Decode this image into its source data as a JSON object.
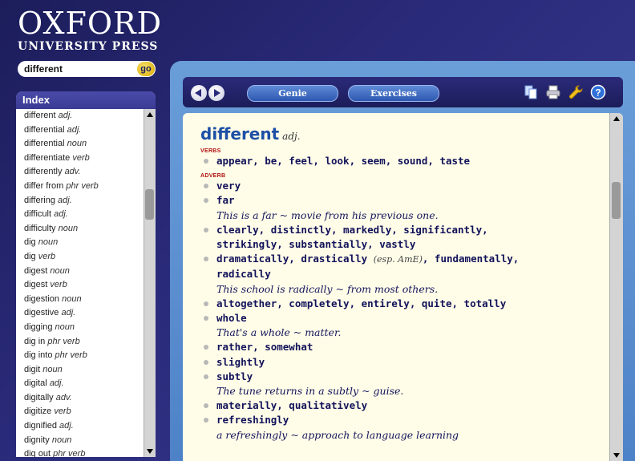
{
  "brand": {
    "name": "OXFORD",
    "subtitle": "UNIVERSITY PRESS"
  },
  "search": {
    "value": "different",
    "go_label": "go"
  },
  "index": {
    "title": "Index",
    "items": [
      {
        "word": "different",
        "pos": "adj."
      },
      {
        "word": "differential",
        "pos": "adj."
      },
      {
        "word": "differential",
        "pos": "noun"
      },
      {
        "word": "differentiate",
        "pos": "verb"
      },
      {
        "word": "differently",
        "pos": "adv."
      },
      {
        "word": "differ from",
        "pos": "phr verb"
      },
      {
        "word": "differing",
        "pos": "adj."
      },
      {
        "word": "difficult",
        "pos": "adj."
      },
      {
        "word": "difficulty",
        "pos": "noun"
      },
      {
        "word": "dig",
        "pos": "noun"
      },
      {
        "word": "dig",
        "pos": "verb"
      },
      {
        "word": "digest",
        "pos": "noun"
      },
      {
        "word": "digest",
        "pos": "verb"
      },
      {
        "word": "digestion",
        "pos": "noun"
      },
      {
        "word": "digestive",
        "pos": "adj."
      },
      {
        "word": "digging",
        "pos": "noun"
      },
      {
        "word": "dig in",
        "pos": "phr verb"
      },
      {
        "word": "dig into",
        "pos": "phr verb"
      },
      {
        "word": "digit",
        "pos": "noun"
      },
      {
        "word": "digital",
        "pos": "adj."
      },
      {
        "word": "digitally",
        "pos": "adv."
      },
      {
        "word": "digitize",
        "pos": "verb"
      },
      {
        "word": "dignified",
        "pos": "adj."
      },
      {
        "word": "dignity",
        "pos": "noun"
      },
      {
        "word": "dig out",
        "pos": "phr verb"
      }
    ]
  },
  "toolbar": {
    "genie_label": "Genie",
    "exercises_label": "Exercises",
    "icons": [
      "copy-icon",
      "print-icon",
      "wrench-icon",
      "help-icon"
    ]
  },
  "entry": {
    "headword": "different",
    "pos": "adj.",
    "sections": [
      {
        "label": "VERBS",
        "lines": [
          {
            "type": "collocate",
            "text": "appear, be, feel, look, seem, sound, taste"
          }
        ]
      },
      {
        "label": "ADVERB",
        "lines": [
          {
            "type": "collocate",
            "text": "very"
          },
          {
            "type": "collocate",
            "text": "far"
          },
          {
            "type": "example",
            "text": "This is a far ~ movie from his previous one."
          },
          {
            "type": "collocate",
            "text": "clearly, distinctly, markedly, significantly,"
          },
          {
            "type": "cont",
            "text": "strikingly, substantially, vastly"
          },
          {
            "type": "collocate",
            "text": "dramatically, drastically",
            "note": "(esp. AmE)",
            "tail": ", fundamentally,"
          },
          {
            "type": "cont",
            "text": "radically"
          },
          {
            "type": "example",
            "text": "This school is radically ~ from most others."
          },
          {
            "type": "collocate",
            "text": "altogether, completely, entirely, quite, totally"
          },
          {
            "type": "collocate",
            "text": "whole"
          },
          {
            "type": "example",
            "text": "That's a whole ~ matter."
          },
          {
            "type": "collocate",
            "text": "rather, somewhat"
          },
          {
            "type": "collocate",
            "text": "slightly"
          },
          {
            "type": "collocate",
            "text": "subtly"
          },
          {
            "type": "example",
            "text": "The tune returns in a subtly ~ guise."
          },
          {
            "type": "collocate",
            "text": "materially, qualitatively"
          },
          {
            "type": "collocate",
            "text": "refreshingly"
          },
          {
            "type": "example",
            "text": "a refreshingly ~ approach to language learning"
          }
        ]
      }
    ]
  },
  "colors": {
    "background": "#2a2a7a",
    "accent_blue": "#1d4fa5",
    "section_red": "#b01010",
    "entry_bg": "#fffde8"
  }
}
